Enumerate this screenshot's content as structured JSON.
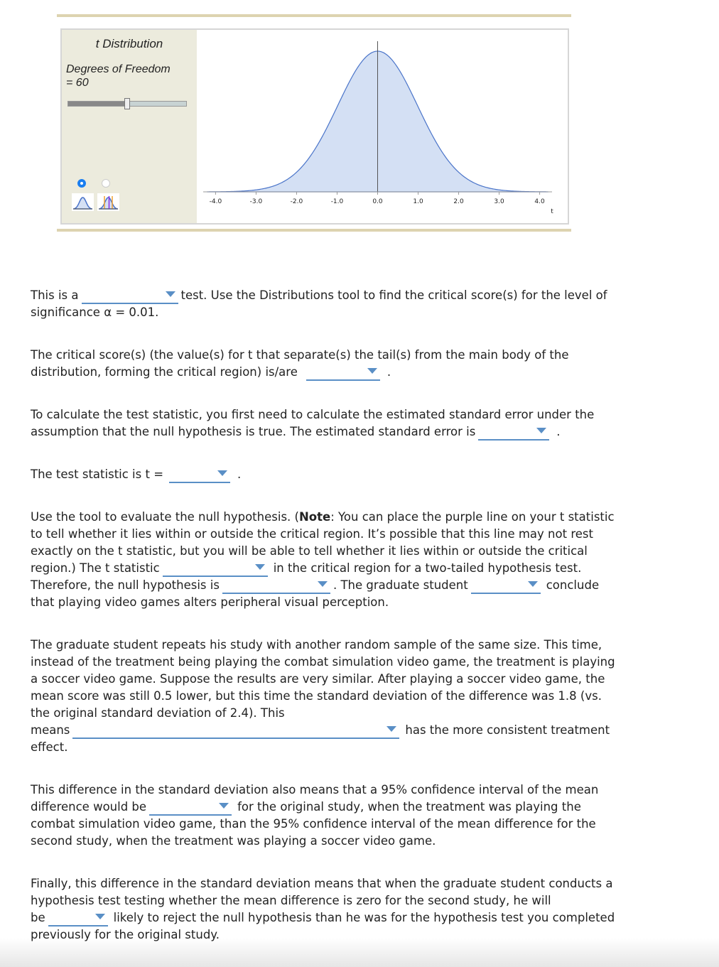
{
  "tool": {
    "title": "t Distribution",
    "dof_label": "Degrees of Freedom",
    "dof_value_text": "= 60",
    "dof_slider_fraction": 0.5,
    "modes": [
      {
        "name": "distribution-only",
        "selected": true
      },
      {
        "name": "distribution-with-lines",
        "selected": false
      }
    ],
    "colors": {
      "curve": "#4a74c9",
      "fill": "#d4e0f4",
      "panel": "#ecebdd",
      "rule": "#ddd3b0",
      "radio": "#1a7ef0"
    }
  },
  "chart_data": {
    "type": "area",
    "title": "t Distribution",
    "df": 60,
    "xlabel": "t",
    "xlim": [
      -4.2,
      4.2
    ],
    "xticks": [
      -4,
      -3,
      -2,
      -1,
      0,
      1,
      2,
      3,
      4
    ],
    "xtick_labels": [
      "-4.0",
      "-3.0",
      "-2.0",
      "-1.0",
      "0.0",
      "1.0",
      "2.0",
      "3.0",
      "4.0"
    ],
    "center_line": 0.0,
    "grid": false
  },
  "questions": {
    "q1": {
      "pre": "This is a",
      "post": "test. Use the Distributions tool to find the critical score(s) for the level of",
      "line2": "significance α = 0.01."
    },
    "q2": {
      "line1": "The critical score(s) (the value(s) for t that separate(s) the tail(s) from the main body of the",
      "line2_pre": "distribution, forming the critical region) is/are",
      "post": "."
    },
    "q3": {
      "line1": "To calculate the test statistic, you first need to calculate the estimated standard error under the",
      "line2_pre": "assumption that the null hypothesis is true. The estimated standard error is",
      "post": "."
    },
    "q4": {
      "pre": "The test statistic is t =",
      "post": "."
    },
    "q5": {
      "l1_pre": "Use the tool to evaluate the null hypothesis. (",
      "l1_bold": "Note",
      "l1_post": ": You can place the purple line on your t statistic",
      "l2": "to tell whether it lies within or outside the critical region. It’s possible that this line may not rest",
      "l3": "exactly on the t statistic, but you will be able to tell whether it lies within or outside the critical",
      "l4_pre": "region.) The t statistic",
      "l4_post": "in the critical region for a two-tailed hypothesis test.",
      "l5_pre": "Therefore, the null hypothesis is",
      "l5_mid": ". The graduate student",
      "l5_post": "conclude",
      "l6": "that playing video games alters peripheral visual perception."
    },
    "q6": {
      "l1": "The graduate student repeats his study with another random sample of the same size. This time,",
      "l2": "instead of the treatment being playing the combat simulation video game, the treatment is playing",
      "l3": "a soccer video game. Suppose the results are very similar. After playing a soccer video game, the",
      "l4": "mean score was still 0.5 lower, but this time the standard deviation of the difference was 1.8 (vs.",
      "l5": "the original standard deviation of 2.4). This",
      "l6_pre": "means",
      "l6_post": "has the more consistent treatment",
      "l7": "effect."
    },
    "q7": {
      "l1": "This difference in the standard deviation also means that a 95% confidence interval of the mean",
      "l2_pre": "difference would be",
      "l2_post": "for the original study, when the treatment was playing the",
      "l3": "combat simulation video game, than the 95% confidence interval of the mean difference for the",
      "l4": "second study, when the treatment was playing a soccer video game."
    },
    "q8": {
      "l1": "Finally, this difference in the standard deviation means that when the graduate student conducts a",
      "l2": "hypothesis test testing whether the mean difference is zero for the second study, he will",
      "l3_pre": "be",
      "l3_post": "likely to reject the null hypothesis than he was for the hypothesis test you completed",
      "l4": "previously for the original study."
    }
  }
}
